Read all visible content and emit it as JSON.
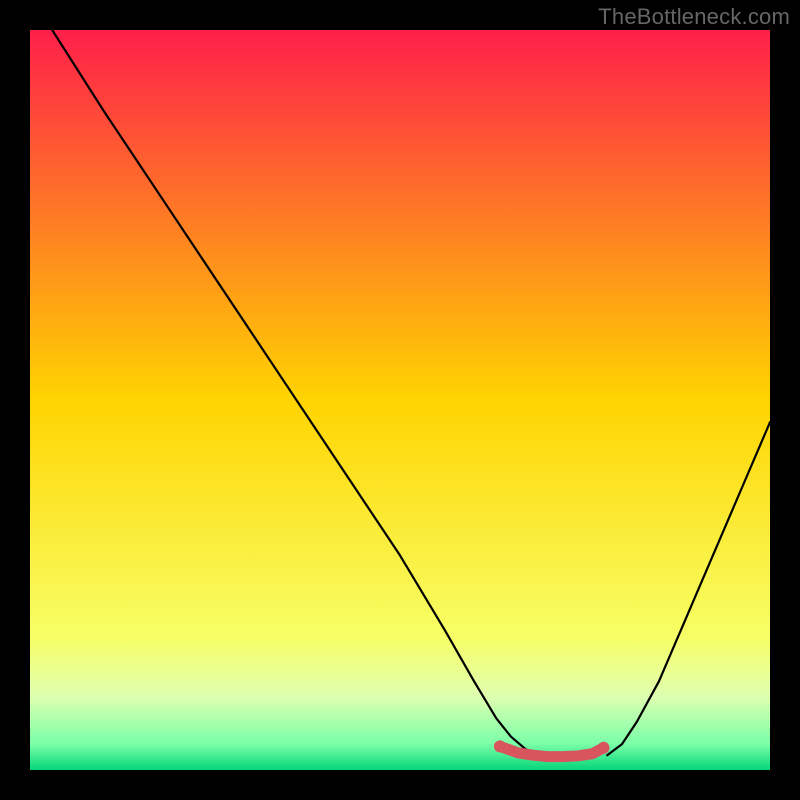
{
  "watermark": "TheBottleneck.com",
  "chart_data": {
    "type": "line",
    "title": "",
    "xlabel": "",
    "ylabel": "",
    "xlim": [
      0,
      100
    ],
    "ylim": [
      0,
      100
    ],
    "grid": false,
    "legend": false,
    "background_gradient_stops": [
      {
        "offset": 0.0,
        "color": "#ff1f4a"
      },
      {
        "offset": 0.5,
        "color": "#ffd400"
      },
      {
        "offset": 0.82,
        "color": "#f7ff66"
      },
      {
        "offset": 0.9,
        "color": "#dfffb0"
      },
      {
        "offset": 0.965,
        "color": "#7affa8"
      },
      {
        "offset": 1.0,
        "color": "#05d57a"
      }
    ],
    "series": [
      {
        "name": "left-curve",
        "color": "#000000",
        "x": [
          3,
          10,
          18,
          26,
          34,
          42,
          50,
          56,
          60,
          63,
          65,
          67,
          69,
          71
        ],
        "y": [
          100,
          89,
          77,
          65,
          53,
          41,
          29,
          19,
          12,
          7,
          4.5,
          2.8,
          2.0,
          1.8
        ]
      },
      {
        "name": "right-curve",
        "color": "#000000",
        "x": [
          78,
          80,
          82,
          85,
          88,
          91,
          94,
          97,
          100
        ],
        "y": [
          2.0,
          3.5,
          6.5,
          12,
          19,
          26,
          33,
          40,
          47
        ]
      },
      {
        "name": "bottom-red-trough",
        "color": "#d9555d",
        "style": "thick-rounded",
        "x": [
          63.5,
          66,
          68,
          70,
          72,
          74,
          76,
          77.5
        ],
        "y": [
          3.2,
          2.3,
          2.0,
          1.8,
          1.8,
          1.9,
          2.2,
          3.0
        ]
      }
    ],
    "markers": [
      {
        "name": "left-red-dot",
        "x": 63.5,
        "y": 3.2,
        "r": 6,
        "color": "#d9555d"
      },
      {
        "name": "right-red-dot",
        "x": 77.5,
        "y": 3.0,
        "r": 6,
        "color": "#d9555d"
      }
    ]
  }
}
